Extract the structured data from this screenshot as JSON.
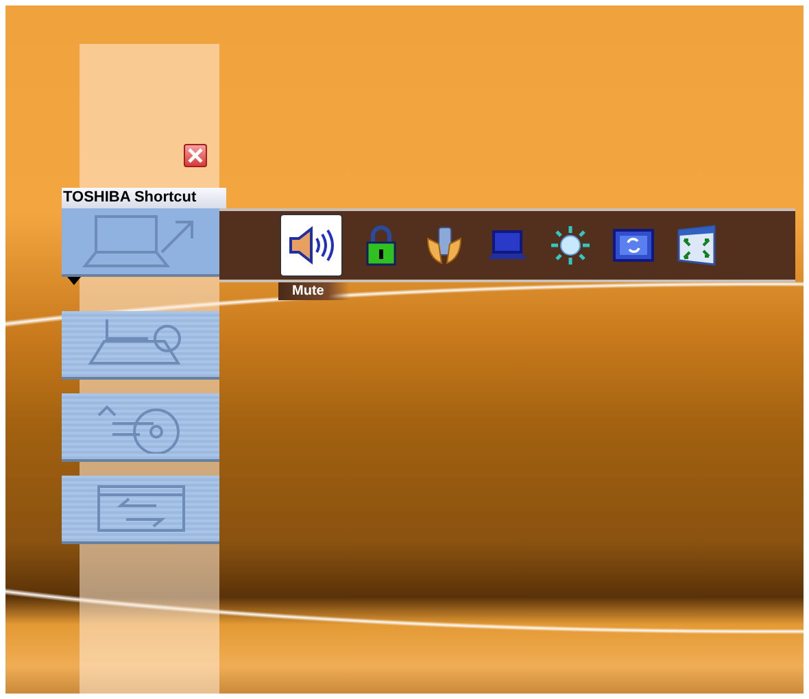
{
  "panel": {
    "title": "TOSHIBA Shortcut"
  },
  "categories": [
    {
      "kind": "laptop-arrow",
      "selected": true
    },
    {
      "kind": "laptop-wrench",
      "selected": false
    },
    {
      "kind": "disc",
      "selected": false
    },
    {
      "kind": "window-arrows",
      "selected": false
    }
  ],
  "tools": [
    {
      "kind": "speaker",
      "selected": true
    },
    {
      "kind": "lock",
      "selected": false
    },
    {
      "kind": "battery",
      "selected": false
    },
    {
      "kind": "laptop",
      "selected": false
    },
    {
      "kind": "brightness",
      "selected": false
    },
    {
      "kind": "refresh",
      "selected": false
    },
    {
      "kind": "fullscreen",
      "selected": false
    }
  ],
  "tooltip": {
    "text": "Mute"
  }
}
